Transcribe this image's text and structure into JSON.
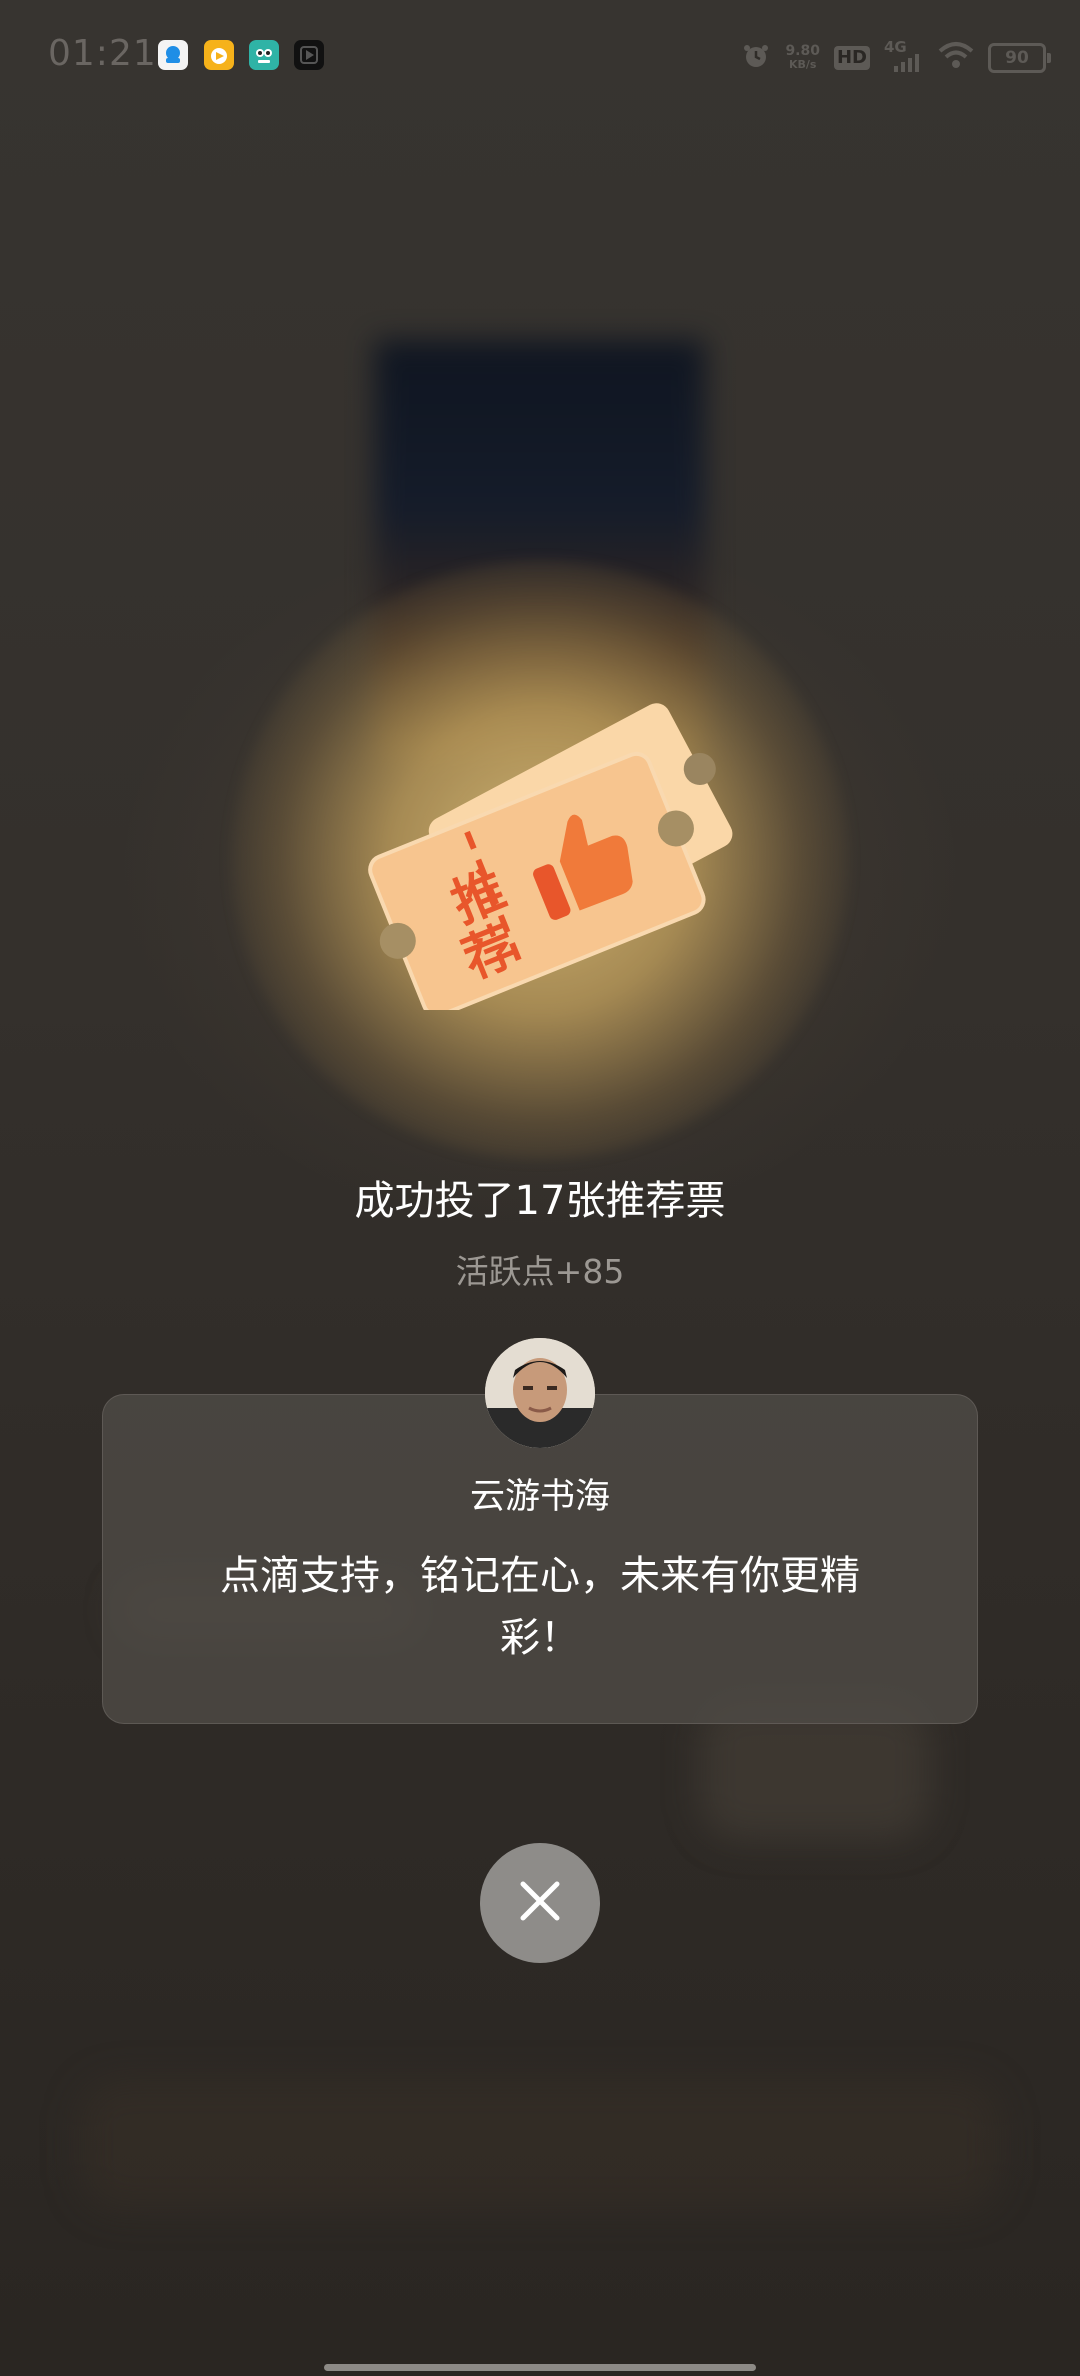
{
  "status_bar": {
    "time": "01:21",
    "network_speed_value": "9.80",
    "network_speed_unit": "KB/s",
    "hd_label": "HD",
    "signal_label": "4G",
    "battery_level": "90",
    "app_icons": [
      "qq-icon",
      "video-app-icon",
      "owl-app-icon",
      "play-app-icon"
    ],
    "status_icons": [
      "alarm-icon",
      "signal-icon",
      "wifi-icon",
      "battery-icon"
    ]
  },
  "ticket": {
    "text_line1": "推",
    "text_line2": "荐",
    "icon": "thumbs-up-icon",
    "colors": {
      "body": "#f7c58f",
      "back": "#fad7a8",
      "accent": "#e8562b"
    }
  },
  "result": {
    "title": "成功投了17张推荐票",
    "subtitle": "活跃点+85"
  },
  "author_card": {
    "author_name": "云游书海",
    "message": "点滴支持，铭记在心，未来有你更精彩！"
  },
  "close_button": {
    "icon": "close-icon"
  }
}
